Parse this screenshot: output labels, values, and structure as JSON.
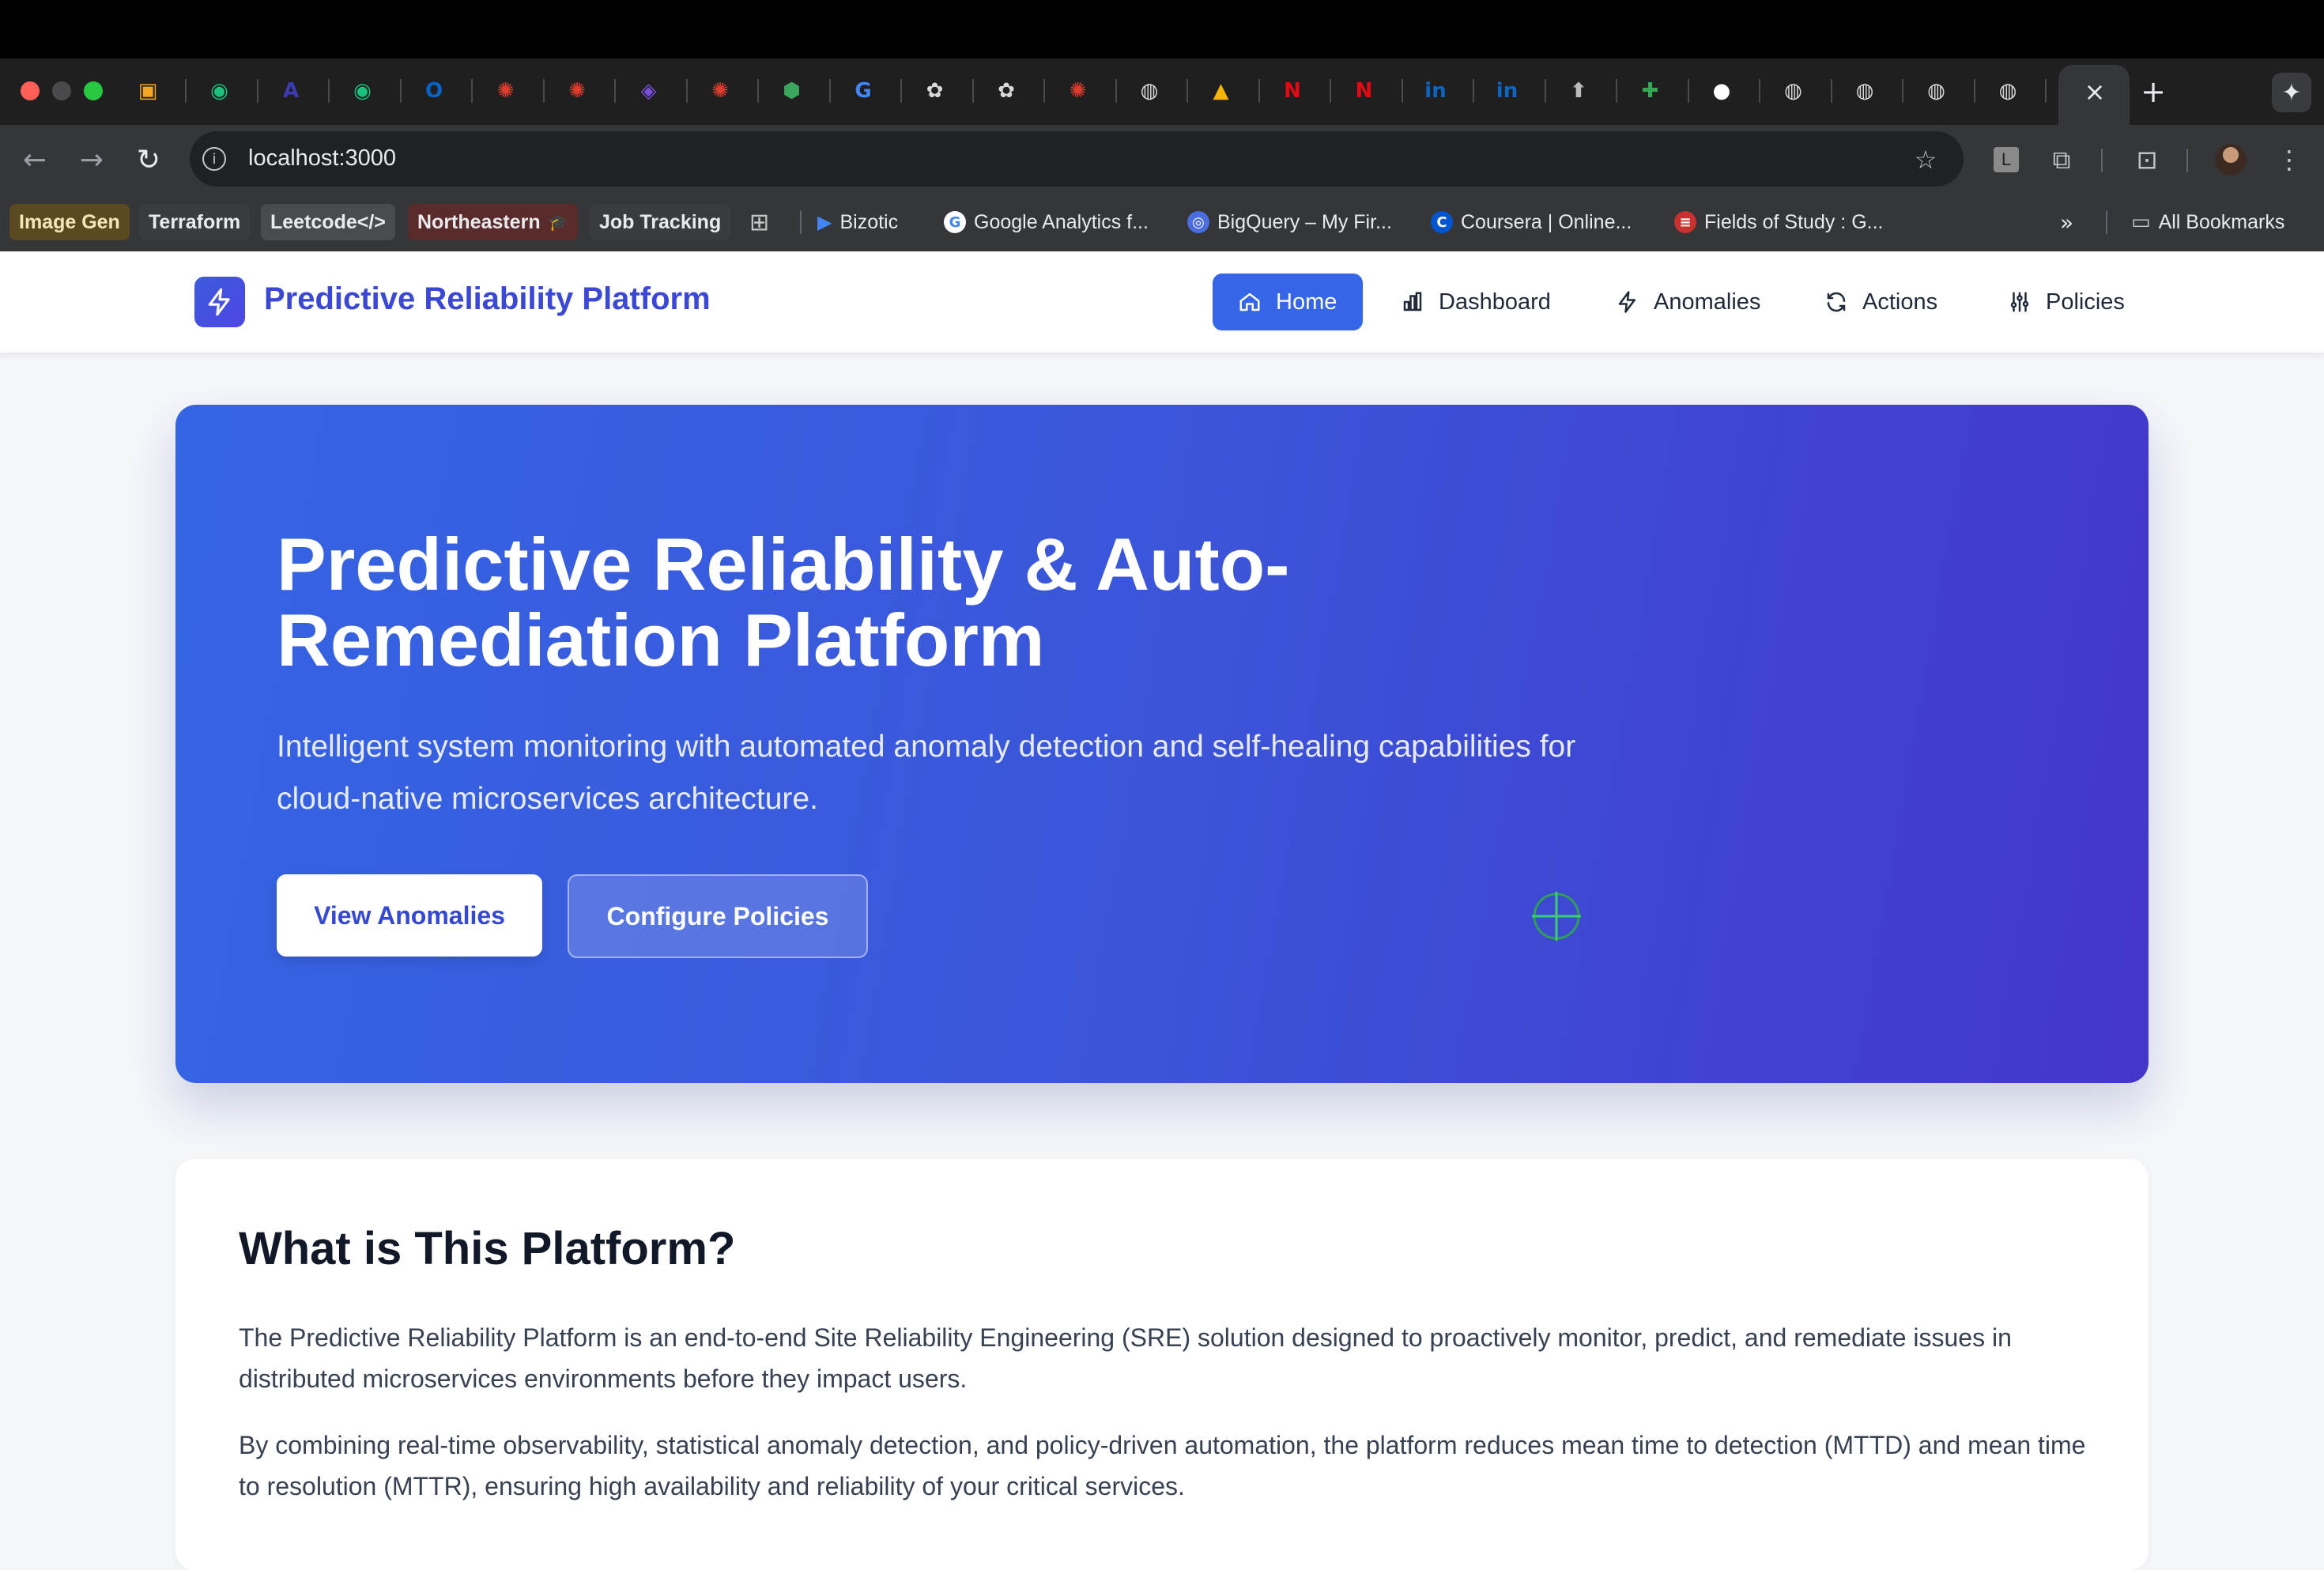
{
  "browser": {
    "active_tab_close": "×",
    "new_tab": "+",
    "tabs": [
      {
        "icon": "box-icon",
        "color": "#f5a623",
        "glyph": "▣"
      },
      {
        "icon": "chat-icon",
        "color": "#19c37d",
        "glyph": "◉"
      },
      {
        "icon": "letter-a-icon",
        "color": "#3b3bb3",
        "glyph": "A"
      },
      {
        "icon": "chat-icon",
        "color": "#19c37d",
        "glyph": "◉"
      },
      {
        "icon": "outlook-icon",
        "color": "#0a64c8",
        "glyph": "O"
      },
      {
        "icon": "asterisk-icon",
        "color": "#e23b2e",
        "glyph": "✺"
      },
      {
        "icon": "asterisk-icon",
        "color": "#e23b2e",
        "glyph": "✺"
      },
      {
        "icon": "shield-icon",
        "color": "#7b4fe0",
        "glyph": "◈"
      },
      {
        "icon": "asterisk-icon",
        "color": "#e23b2e",
        "glyph": "✺"
      },
      {
        "icon": "hexagon-icon",
        "color": "#3aa55d",
        "glyph": "⬢"
      },
      {
        "icon": "google-icon",
        "color": "#4285f4",
        "glyph": "G"
      },
      {
        "icon": "openai-icon",
        "color": "#d9d9d9",
        "glyph": "✿"
      },
      {
        "icon": "openai-icon",
        "color": "#d9d9d9",
        "glyph": "✿"
      },
      {
        "icon": "asterisk-icon",
        "color": "#e23b2e",
        "glyph": "✺"
      },
      {
        "icon": "globe-icon",
        "color": "#d9d9d9",
        "glyph": "◍"
      },
      {
        "icon": "drive-icon",
        "color": "#f4b400",
        "glyph": "▲"
      },
      {
        "icon": "netflix-icon",
        "color": "#e50914",
        "glyph": "N"
      },
      {
        "icon": "netflix-icon",
        "color": "#e50914",
        "glyph": "N"
      },
      {
        "icon": "linkedin-icon",
        "color": "#0a66c2",
        "glyph": "in"
      },
      {
        "icon": "linkedin-icon",
        "color": "#0a66c2",
        "glyph": "in"
      },
      {
        "icon": "grad-cap-icon",
        "color": "#bbbbbb",
        "glyph": "⬆"
      },
      {
        "icon": "sheets-icon",
        "color": "#34a853",
        "glyph": "✚"
      },
      {
        "icon": "github-icon",
        "color": "#ffffff",
        "glyph": "●"
      },
      {
        "icon": "globe-icon",
        "color": "#d9d9d9",
        "glyph": "◍"
      },
      {
        "icon": "globe-icon",
        "color": "#d9d9d9",
        "glyph": "◍"
      },
      {
        "icon": "globe-icon",
        "color": "#d9d9d9",
        "glyph": "◍"
      },
      {
        "icon": "globe-icon",
        "color": "#d9d9d9",
        "glyph": "◍"
      }
    ],
    "url": "localhost:3000",
    "bookmarks": {
      "image_gen": "Image Gen",
      "terraform": "Terraform",
      "leetcode": "Leetcode</>",
      "northeastern": "Northeastern",
      "job_tracking": "Job Tracking",
      "bizotic": "Bizotic",
      "google_analytics": "Google Analytics f...",
      "bigquery": "BigQuery – My Fir...",
      "coursera": "Coursera | Online...",
      "fields_of_study": "Fields of Study : G...",
      "overflow": "»",
      "all_bookmarks": "All Bookmarks"
    },
    "profile_letter": "L"
  },
  "app": {
    "brand": "Predictive Reliability Platform",
    "nav": {
      "home": "Home",
      "dashboard": "Dashboard",
      "anomalies": "Anomalies",
      "actions": "Actions",
      "policies": "Policies"
    },
    "colors": {
      "primary": "#3566e8",
      "hero_start": "#3565e3",
      "hero_end": "#4336c9"
    }
  },
  "hero": {
    "title": "Predictive Reliability & Auto-Remediation Platform",
    "description": "Intelligent system monitoring with automated anomaly detection and self-healing capabilities for cloud-native microservices architecture.",
    "btn_primary": "View Anomalies",
    "btn_secondary": "Configure Policies"
  },
  "info": {
    "title": "What is This Platform?",
    "p1": "The Predictive Reliability Platform is an end-to-end Site Reliability Engineering (SRE) solution designed to proactively monitor, predict, and remediate issues in distributed microservices environments before they impact users.",
    "p2": "By combining real-time observability, statistical anomaly detection, and policy-driven automation, the platform reduces mean time to detection (MTTD) and mean time to resolution (MTTR), ensuring high availability and reliability of your critical services."
  }
}
